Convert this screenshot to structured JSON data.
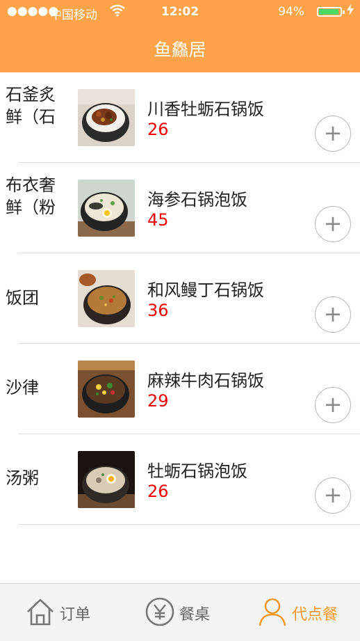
{
  "status_bar": {
    "signal": "●●●●●",
    "carrier": "中国移动",
    "time": "12:02",
    "battery_percent": "94%",
    "battery_level": 0.94,
    "battery_color": "#4cd964"
  },
  "header": {
    "title": "鱼鱻居",
    "color": "#fda44a"
  },
  "categories": [
    {
      "label": "石釜炙鲜（石"
    },
    {
      "label": "布衣奢鲜（粉"
    },
    {
      "label": "饭团"
    },
    {
      "label": "沙律"
    },
    {
      "label": "汤粥"
    }
  ],
  "menu": {
    "items": [
      {
        "name": "川香牡蛎石锅饭",
        "price": "26",
        "add": "+"
      },
      {
        "name": "海参石锅泡饭",
        "price": "45",
        "add": "+"
      },
      {
        "name": "和风鳗丁石锅饭",
        "price": "36",
        "add": "+"
      },
      {
        "name": "麻辣牛肉石锅饭",
        "price": "29",
        "add": "+"
      },
      {
        "name": "牡蛎石锅泡饭",
        "price": "26",
        "add": "+"
      }
    ],
    "price_color": "#f00000"
  },
  "tabbar": {
    "tabs": [
      {
        "label": "订单",
        "icon": "home-icon"
      },
      {
        "label": "餐桌",
        "icon": "yen-icon"
      },
      {
        "label": "代点餐",
        "icon": "user-icon",
        "active": true
      }
    ],
    "active_color": "#f39a2a"
  }
}
